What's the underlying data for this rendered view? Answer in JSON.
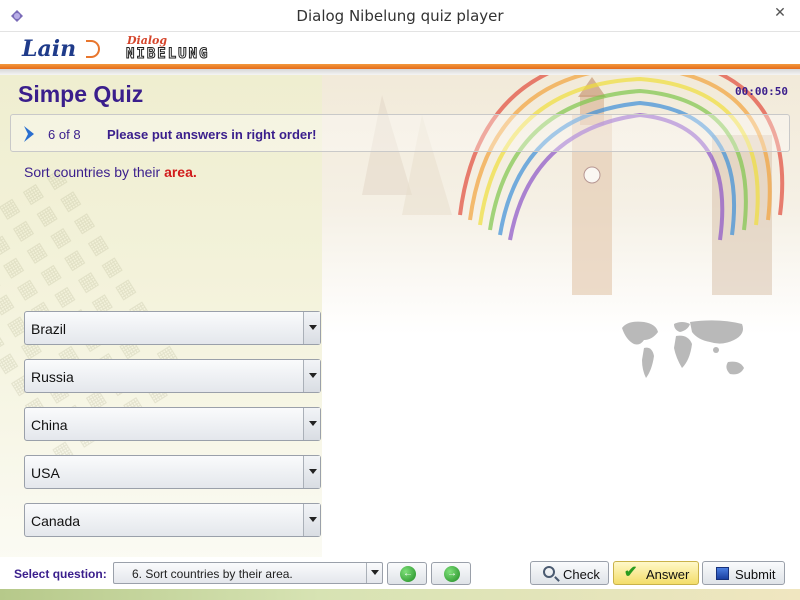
{
  "window": {
    "title": "Dialog Nibelung quiz player",
    "close_glyph": "✕"
  },
  "header": {
    "logo_lain": "Lain",
    "logo_dialog": "Dialog",
    "logo_nibelung": "NIBELUNG"
  },
  "quiz": {
    "title": "Simpe Quiz",
    "timer": "00:00:50",
    "question_number": "6",
    "question_total_text": "of 8",
    "instruction": "Please put answers in right order!",
    "prompt_prefix": "Sort countries by their ",
    "prompt_highlight": "area."
  },
  "order_slots": [
    {
      "value": "Brazil"
    },
    {
      "value": "Russia"
    },
    {
      "value": "China"
    },
    {
      "value": "USA"
    },
    {
      "value": "Canada"
    }
  ],
  "bottom": {
    "select_label": "Select question:",
    "select_value": "6. Sort countries by their area.",
    "check_label": "Check",
    "answer_label": "Answer",
    "submit_label": "Submit"
  },
  "colors": {
    "accent_text": "#3a1e8c",
    "highlight": "#d11b1b",
    "orange_stripe": "#e56b1a"
  },
  "icons": {
    "app": "app-icon",
    "chevron": "chevron-right-icon",
    "prev": "arrow-left-circle-icon",
    "next": "arrow-right-circle-icon",
    "check": "magnifier-icon",
    "answer": "checkmark-icon",
    "submit": "submit-square-icon"
  }
}
